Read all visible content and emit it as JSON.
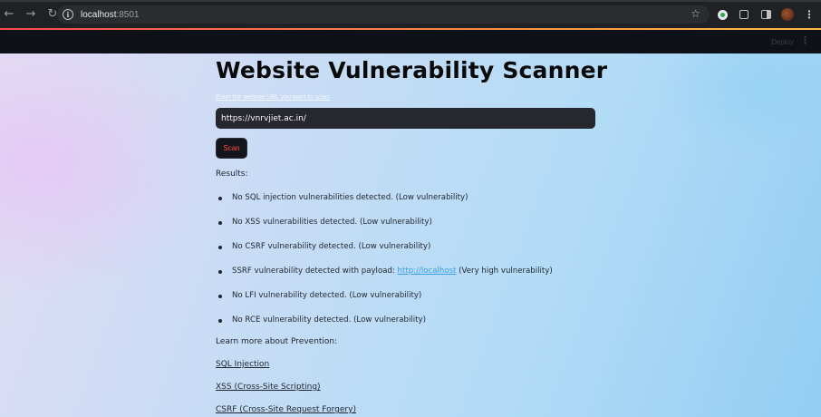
{
  "browser": {
    "url_host": "localhost",
    "url_port": ":8501"
  },
  "app_header": {
    "deploy_label": "Deploy",
    "menu_glyph": "⋮"
  },
  "main": {
    "title": "Website Vulnerability Scanner",
    "input_label": "Enter the website URL you want to scan:",
    "url_value": "https://vnrvjiet.ac.in/",
    "scan_button": "Scan",
    "results_label": "Results:",
    "results": [
      {
        "text": "No SQL injection vulnerabilities detected. (Low vulnerability)"
      },
      {
        "text": "No XSS vulnerabilities detected. (Low vulnerability)"
      },
      {
        "text": "No CSRF vulnerability detected. (Low vulnerability)"
      },
      {
        "text_before": "SSRF vulnerability detected with payload: ",
        "link": "http://localhost",
        "text_after": " (Very high vulnerability)"
      },
      {
        "text": "No LFI vulnerability detected. (Low vulnerability)"
      },
      {
        "text": "No RCE vulnerability detected. (Low vulnerability)"
      }
    ],
    "prevention_label": "Learn more about Prevention:",
    "prevention_links": [
      {
        "label": "SQL Injection"
      },
      {
        "label": "XSS (Cross-Site Scripting)"
      },
      {
        "label": "CSRF (Cross-Site Request Forgery)"
      }
    ]
  },
  "colors": {
    "accent_red": "#ff4b4b",
    "link_blue": "#3aa0e6",
    "input_bg": "#26272f"
  }
}
